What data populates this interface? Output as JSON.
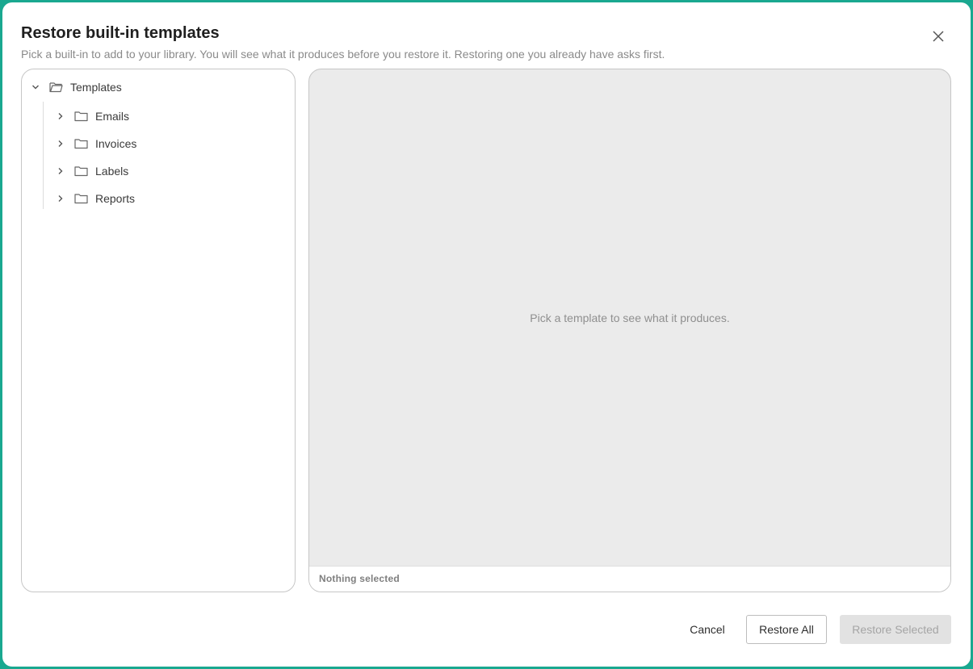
{
  "dialog": {
    "title": "Restore built-in templates",
    "subtitle": "Pick a built-in to add to your library. You will see what it produces before you restore it. Restoring one you already have asks first.",
    "close_icon": "close-icon"
  },
  "tree": {
    "root": {
      "label": "Templates",
      "expanded": true,
      "icon": "folder-open-icon"
    },
    "children": [
      {
        "label": "Emails",
        "expanded": false,
        "icon": "folder-icon"
      },
      {
        "label": "Invoices",
        "expanded": false,
        "icon": "folder-icon"
      },
      {
        "label": "Labels",
        "expanded": false,
        "icon": "folder-icon"
      },
      {
        "label": "Reports",
        "expanded": false,
        "icon": "folder-icon"
      }
    ]
  },
  "preview": {
    "empty_message": "Pick a template to see what it produces.",
    "status": "Nothing selected"
  },
  "footer": {
    "cancel_label": "Cancel",
    "restore_all_label": "Restore All",
    "restore_selected_label": "Restore Selected",
    "restore_selected_enabled": false
  },
  "colors": {
    "frame": "#1aa890",
    "preview_background": "#ebebeb",
    "disabled_button": "#e2e2e2"
  }
}
